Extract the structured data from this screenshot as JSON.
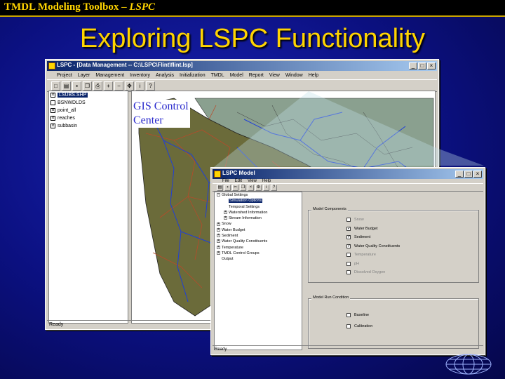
{
  "slide": {
    "header": {
      "title_main": "TMDL Modeling Toolbox – ",
      "title_italic": "LSPC"
    },
    "title": "Exploring LSPC Functionality"
  },
  "main_window": {
    "title": "LSPC - [Data Management -- C:\\LSPC\\Flint\\flint.lsp]",
    "controls": [
      "_",
      "□",
      "×"
    ],
    "menu": [
      "Project",
      "Layer",
      "Management",
      "Inventory",
      "Analysis",
      "Initialization",
      "TMDL",
      "Model",
      "Report",
      "View",
      "Window",
      "Help"
    ],
    "toolbar_icons": [
      "new-icon",
      "open-icon",
      "save-icon",
      "copy-icon",
      "print-icon",
      "zoom-in-icon",
      "zoom-out-icon",
      "pan-icon",
      "identify-icon",
      "help-icon"
    ],
    "layers": [
      {
        "label": "LSUBS.SHP",
        "checked": true,
        "selected": true
      },
      {
        "label": "BSNWDLDS",
        "checked": false,
        "selected": false
      },
      {
        "label": "point_all",
        "checked": true,
        "selected": false
      },
      {
        "label": "reaches",
        "checked": true,
        "selected": false
      },
      {
        "label": "subbasin",
        "checked": true,
        "selected": false
      }
    ],
    "status": "Ready"
  },
  "gis_label": {
    "line1": "GIS Control",
    "line2": "Center"
  },
  "model_window": {
    "title": "LSPC Model",
    "controls": [
      "_",
      "□",
      "×"
    ],
    "menu": [
      "File",
      "Edit",
      "View",
      "Help"
    ],
    "tree": [
      {
        "label": "Global Settings",
        "level": 0,
        "expander": "-"
      },
      {
        "label": "Simulation Options",
        "level": 1,
        "expander": "",
        "selected": true
      },
      {
        "label": "Temporal Settings",
        "level": 1,
        "expander": ""
      },
      {
        "label": "Watershed Information",
        "level": 1,
        "expander": "+"
      },
      {
        "label": "Stream Information",
        "level": 1,
        "expander": "+"
      },
      {
        "label": "Snow",
        "level": 0,
        "expander": "+"
      },
      {
        "label": "Water Budget",
        "level": 0,
        "expander": "+"
      },
      {
        "label": "Sediment",
        "level": 0,
        "expander": "+"
      },
      {
        "label": "Water Quality Constituents",
        "level": 0,
        "expander": "+"
      },
      {
        "label": "Temperature",
        "level": 0,
        "expander": "+"
      },
      {
        "label": "TMDL Control Groups",
        "level": 0,
        "expander": "+"
      },
      {
        "label": "Output",
        "level": 0,
        "expander": ""
      }
    ],
    "model_components": {
      "legend": "Model Components",
      "options": [
        {
          "label": "Snow",
          "checked": false,
          "enabled": false
        },
        {
          "label": "Water Budget",
          "checked": true,
          "enabled": true
        },
        {
          "label": "Sediment",
          "checked": true,
          "enabled": true
        },
        {
          "label": "Water Quality Constituents",
          "checked": true,
          "enabled": true
        },
        {
          "label": "Temperature",
          "checked": false,
          "enabled": false
        },
        {
          "label": "pH",
          "checked": false,
          "enabled": false
        },
        {
          "label": "Dissolved Oxygen",
          "checked": false,
          "enabled": false
        }
      ]
    },
    "model_run": {
      "legend": "Model Run Condition",
      "options": [
        {
          "label": "Baseline",
          "checked": false,
          "enabled": true
        },
        {
          "label": "Calibration",
          "checked": false,
          "enabled": true
        }
      ]
    },
    "status": "Ready"
  },
  "colors": {
    "accent": "#ffd400",
    "titlebar": "#0a246a",
    "watershed": "#6b6b3a",
    "lake": "#8aa08f"
  }
}
